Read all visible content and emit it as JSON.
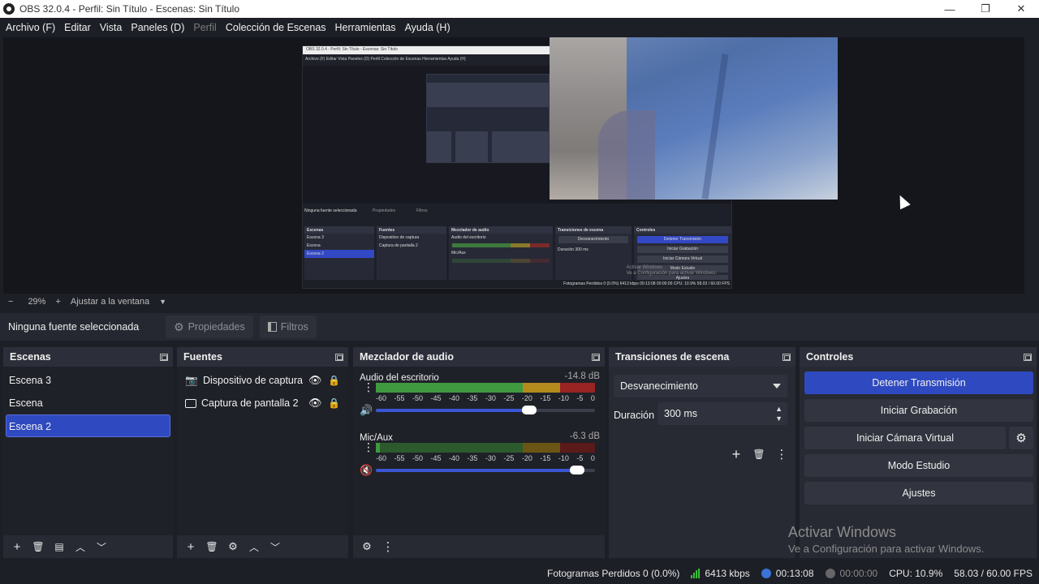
{
  "window": {
    "title": "OBS 32.0.4 - Perfil: Sin Título - Escenas: Sin Título",
    "minimize": "—",
    "restore": "❐",
    "close": "✕"
  },
  "menu": [
    "Archivo (F)",
    "Editar",
    "Vista",
    "Paneles (D)",
    "Perfil",
    "Colección de Escenas",
    "Herramientas",
    "Ayuda (H)"
  ],
  "nested_preview": {
    "title": "OBS 32.0.4 - Perfil: Sin Título - Escenas: Sin Título",
    "menu": "Archivo (F)   Editar   Vista   Paneles (D)   Perfil   Colección de Escenas   Herramientas   Ayuda (H)",
    "no_source": "Ninguna fuente seleccionada",
    "props": "Propiedades",
    "filters": "Filtros",
    "scenes_title": "Escenas",
    "scenes": [
      "Escena 3",
      "Escena",
      "Escena 2"
    ],
    "sources_title": "Fuentes",
    "sources": [
      "Dispositivo de captura",
      "Captura de pantalla 2"
    ],
    "mixer_title": "Mezclador de audio",
    "mixer_ch1": "Audio del escritorio",
    "mixer_ch2": "Mic/Aux",
    "trans_title": "Transiciones de escena",
    "trans_value": "Desvanecimiento",
    "trans_dur": "Duración   300 ms",
    "controls_title": "Controles",
    "controls": [
      "Detener Transmisión",
      "Iniciar Grabación",
      "Iniciar Cámara Virtual",
      "Modo Estudio",
      "Ajustes"
    ],
    "watermark1": "Activar Windows",
    "watermark2": "Ve a Configuración para activar Windows.",
    "status": "Fotogramas Perdidos 0 (0.0%)   6413 kbps   00:13:08   00:00:00   CPU: 10.9%   58.03 / 60.00 FPS"
  },
  "zoom": {
    "minus": "−",
    "value": "29%",
    "plus": "+",
    "fit": "Ajustar a la ventana"
  },
  "source_toolbar": {
    "no_source": "Ninguna fuente seleccionada",
    "properties": "Propiedades",
    "filters": "Filtros"
  },
  "scenes": {
    "title": "Escenas",
    "items": [
      "Escena 3",
      "Escena",
      "Escena 2"
    ],
    "selected_index": 2
  },
  "sources": {
    "title": "Fuentes",
    "items": [
      {
        "icon": "camera-icon",
        "label": "Dispositivo de captura"
      },
      {
        "icon": "monitor-icon",
        "label": "Captura de pantalla 2"
      }
    ]
  },
  "mixer": {
    "title": "Mezclador de audio",
    "scale": [
      "-60",
      "-55",
      "-50",
      "-45",
      "-40",
      "-35",
      "-30",
      "-25",
      "-20",
      "-15",
      "-10",
      "-5",
      "0"
    ],
    "channels": [
      {
        "name": "Audio del escritorio",
        "db": "-14.8 dB",
        "level": 1.0,
        "volume": 0.7,
        "muted": false
      },
      {
        "name": "Mic/Aux",
        "db": "-6.3 dB",
        "level": 0.02,
        "volume": 0.92,
        "muted": true
      }
    ]
  },
  "transitions": {
    "title": "Transiciones de escena",
    "selected": "Desvanecimiento",
    "duration_label": "Duración",
    "duration_value": "300 ms"
  },
  "controls": {
    "title": "Controles",
    "stop_stream": "Detener Transmisión",
    "start_recording": "Iniciar Grabación",
    "start_virtual_cam": "Iniciar Cámara Virtual",
    "studio_mode": "Modo Estudio",
    "settings": "Ajustes"
  },
  "watermark": {
    "line1": "Activar Windows",
    "line2": "Ve a Configuración para activar Windows."
  },
  "status": {
    "dropped_frames": "Fotogramas Perdidos 0 (0.0%)",
    "bitrate": "6413 kbps",
    "stream_time": "00:13:08",
    "record_time": "00:00:00",
    "cpu": "CPU: 10.9%",
    "fps": "58.03 / 60.00 FPS"
  },
  "colors": {
    "accent": "#2f4ac0",
    "meter_green": "#3f9a3f",
    "meter_yellow": "#b38a1e",
    "meter_red": "#9a2323",
    "meter_green_dim": "#2c5a2c",
    "meter_yellow_dim": "#6b5514",
    "meter_red_dim": "#5a1a1a"
  }
}
